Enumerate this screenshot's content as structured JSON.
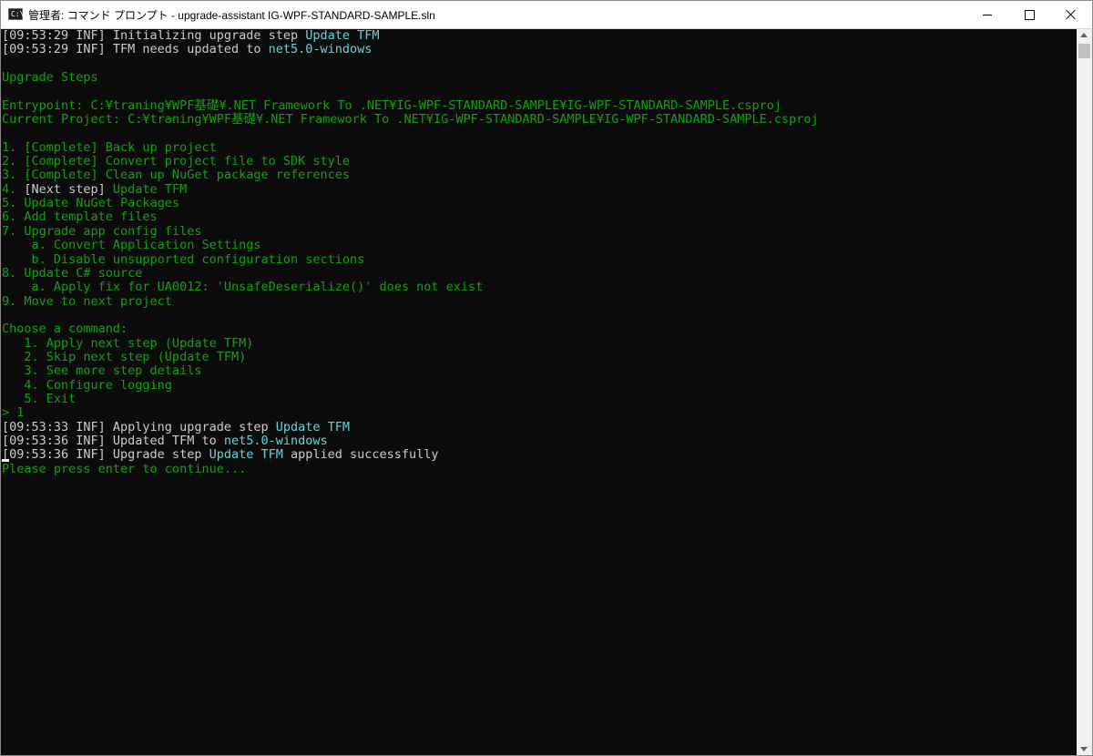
{
  "window": {
    "title": "管理者: コマンド プロンプト - upgrade-assistant  IG-WPF-STANDARD-SAMPLE.sln",
    "icon": "terminal-icon",
    "icon_text": "C:\\",
    "controls": [
      "minimize-icon",
      "maximize-icon",
      "close-icon"
    ]
  },
  "colors": {
    "background": "#0c0c0c",
    "default_text": "#cccccc",
    "green": "#13a10e",
    "cyan": "#61d6d6"
  },
  "console": {
    "lines": [
      [
        {
          "t": "[09:53:29 INF] Initializing upgrade step ",
          "c": "w"
        },
        {
          "t": "Update TFM",
          "c": "c"
        }
      ],
      [
        {
          "t": "[09:53:29 INF] TFM needs updated to ",
          "c": "w"
        },
        {
          "t": "net5.0-windows",
          "c": "c"
        }
      ],
      [],
      [
        {
          "t": "Upgrade Steps",
          "c": "g"
        }
      ],
      [],
      [
        {
          "t": "Entrypoint: C:¥traning¥WPF基礎¥.NET Framework To .NET¥IG-WPF-STANDARD-SAMPLE¥IG-WPF-STANDARD-SAMPLE.csproj",
          "c": "g"
        }
      ],
      [
        {
          "t": "Current Project: C:¥traning¥WPF基礎¥.NET Framework To .NET¥IG-WPF-STANDARD-SAMPLE¥IG-WPF-STANDARD-SAMPLE.csproj",
          "c": "g"
        }
      ],
      [],
      [
        {
          "t": "1. [Complete] Back up project",
          "c": "g"
        }
      ],
      [
        {
          "t": "2. [Complete] Convert project file to SDK style",
          "c": "g"
        }
      ],
      [
        {
          "t": "3. [Complete] Clean up NuGet package references",
          "c": "g"
        }
      ],
      [
        {
          "t": "4. ",
          "c": "g"
        },
        {
          "t": "[Next step]",
          "c": "w"
        },
        {
          "t": " Update TFM",
          "c": "g"
        }
      ],
      [
        {
          "t": "5. Update NuGet Packages",
          "c": "g"
        }
      ],
      [
        {
          "t": "6. Add template files",
          "c": "g"
        }
      ],
      [
        {
          "t": "7. Upgrade app config files",
          "c": "g"
        }
      ],
      [
        {
          "t": "    a. Convert Application Settings",
          "c": "g"
        }
      ],
      [
        {
          "t": "    b. Disable unsupported configuration sections",
          "c": "g"
        }
      ],
      [
        {
          "t": "8. Update C# source",
          "c": "g"
        }
      ],
      [
        {
          "t": "    a. Apply fix for UA0012: 'UnsafeDeserialize()' does not exist",
          "c": "g"
        }
      ],
      [
        {
          "t": "9. Move to next project",
          "c": "g"
        }
      ],
      [],
      [
        {
          "t": "Choose a command:",
          "c": "g"
        }
      ],
      [
        {
          "t": "   1. Apply next step (Update TFM)",
          "c": "g"
        }
      ],
      [
        {
          "t": "   2. Skip next step (Update TFM)",
          "c": "g"
        }
      ],
      [
        {
          "t": "   3. See more step details",
          "c": "g"
        }
      ],
      [
        {
          "t": "   4. Configure logging",
          "c": "g"
        }
      ],
      [
        {
          "t": "   5. Exit",
          "c": "g"
        }
      ],
      [
        {
          "t": "> 1",
          "c": "g"
        }
      ],
      [
        {
          "t": "[09:53:33 INF] Applying upgrade step ",
          "c": "w"
        },
        {
          "t": "Update TFM",
          "c": "c"
        }
      ],
      [
        {
          "t": "[09:53:36 INF] Updated TFM to ",
          "c": "w"
        },
        {
          "t": "net5.0-windows",
          "c": "c"
        }
      ],
      [
        {
          "t": "[09:53:36 INF] Upgrade step ",
          "c": "w"
        },
        {
          "t": "Update TFM",
          "c": "c"
        },
        {
          "t": " applied successfully",
          "c": "w"
        }
      ],
      [
        {
          "t": "Please press enter to continue...",
          "c": "g"
        }
      ]
    ]
  }
}
